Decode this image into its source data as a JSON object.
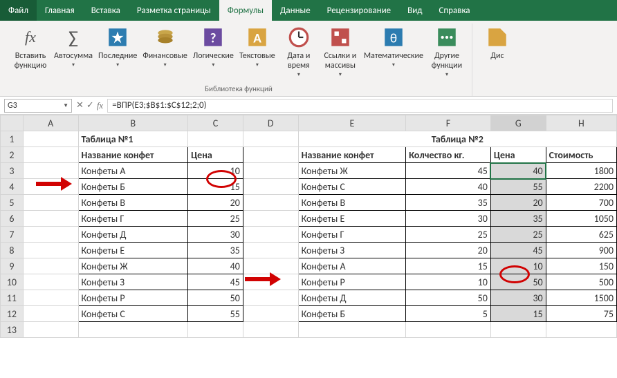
{
  "tabs": {
    "file": "Файл",
    "home": "Главная",
    "insert": "Вставка",
    "layout": "Разметка страницы",
    "formulas": "Формулы",
    "data": "Данные",
    "review": "Рецензирование",
    "view": "Вид",
    "help": "Справка"
  },
  "ribbon": {
    "insert_fn": "Вставить\nфункцию",
    "autosum": "Автосумма",
    "recent": "Последние",
    "financial": "Финансовые",
    "logical": "Логические",
    "text": "Текстовые",
    "datetime": "Дата и\nвремя",
    "lookup": "Ссылки и\nмассивы",
    "math": "Математические",
    "more": "Другие\nфункции",
    "dispatcher": "Дис",
    "group_label": "Библиотека функций"
  },
  "namebox": "G3",
  "formula": "=ВПР(E3;$B$1:$C$12;2;0)",
  "colHeaders": [
    "A",
    "B",
    "C",
    "D",
    "E",
    "F",
    "G",
    "H"
  ],
  "tables": {
    "t1_title": "Таблица №1",
    "t2_title": "Таблица №2",
    "t1_h1": "Название конфет",
    "t1_h2": "Цена",
    "t2_h1": "Название конфет",
    "t2_h2": "Колчество кг.",
    "t2_h3": "Цена",
    "t2_h4": "Стоимость",
    "t1": [
      {
        "name": "Конфеты А",
        "price": 10
      },
      {
        "name": "Конфеты Б",
        "price": 15
      },
      {
        "name": "Конфеты В",
        "price": 20
      },
      {
        "name": "Конфеты Г",
        "price": 25
      },
      {
        "name": "Конфеты Д",
        "price": 30
      },
      {
        "name": "Конфеты Е",
        "price": 35
      },
      {
        "name": "Конфеты Ж",
        "price": 40
      },
      {
        "name": "Конфеты З",
        "price": 45
      },
      {
        "name": "Конфеты Р",
        "price": 50
      },
      {
        "name": "Конфеты С",
        "price": 55
      }
    ],
    "t2": [
      {
        "name": "Конфеты Ж",
        "qty": 45,
        "price": 40,
        "cost": 1800
      },
      {
        "name": "Конфеты С",
        "qty": 40,
        "price": 55,
        "cost": 2200
      },
      {
        "name": "Конфеты В",
        "qty": 35,
        "price": 20,
        "cost": 700
      },
      {
        "name": "Конфеты Е",
        "qty": 30,
        "price": 35,
        "cost": 1050
      },
      {
        "name": "Конфеты Г",
        "qty": 25,
        "price": 25,
        "cost": 625
      },
      {
        "name": "Конфеты З",
        "qty": 20,
        "price": 45,
        "cost": 900
      },
      {
        "name": "Конфеты А",
        "qty": 15,
        "price": 10,
        "cost": 150
      },
      {
        "name": "Конфеты Р",
        "qty": 10,
        "price": 50,
        "cost": 500
      },
      {
        "name": "Конфеты Д",
        "qty": 50,
        "price": 30,
        "cost": 1500
      },
      {
        "name": "Конфеты Б",
        "qty": 5,
        "price": 15,
        "cost": 75
      }
    ]
  }
}
